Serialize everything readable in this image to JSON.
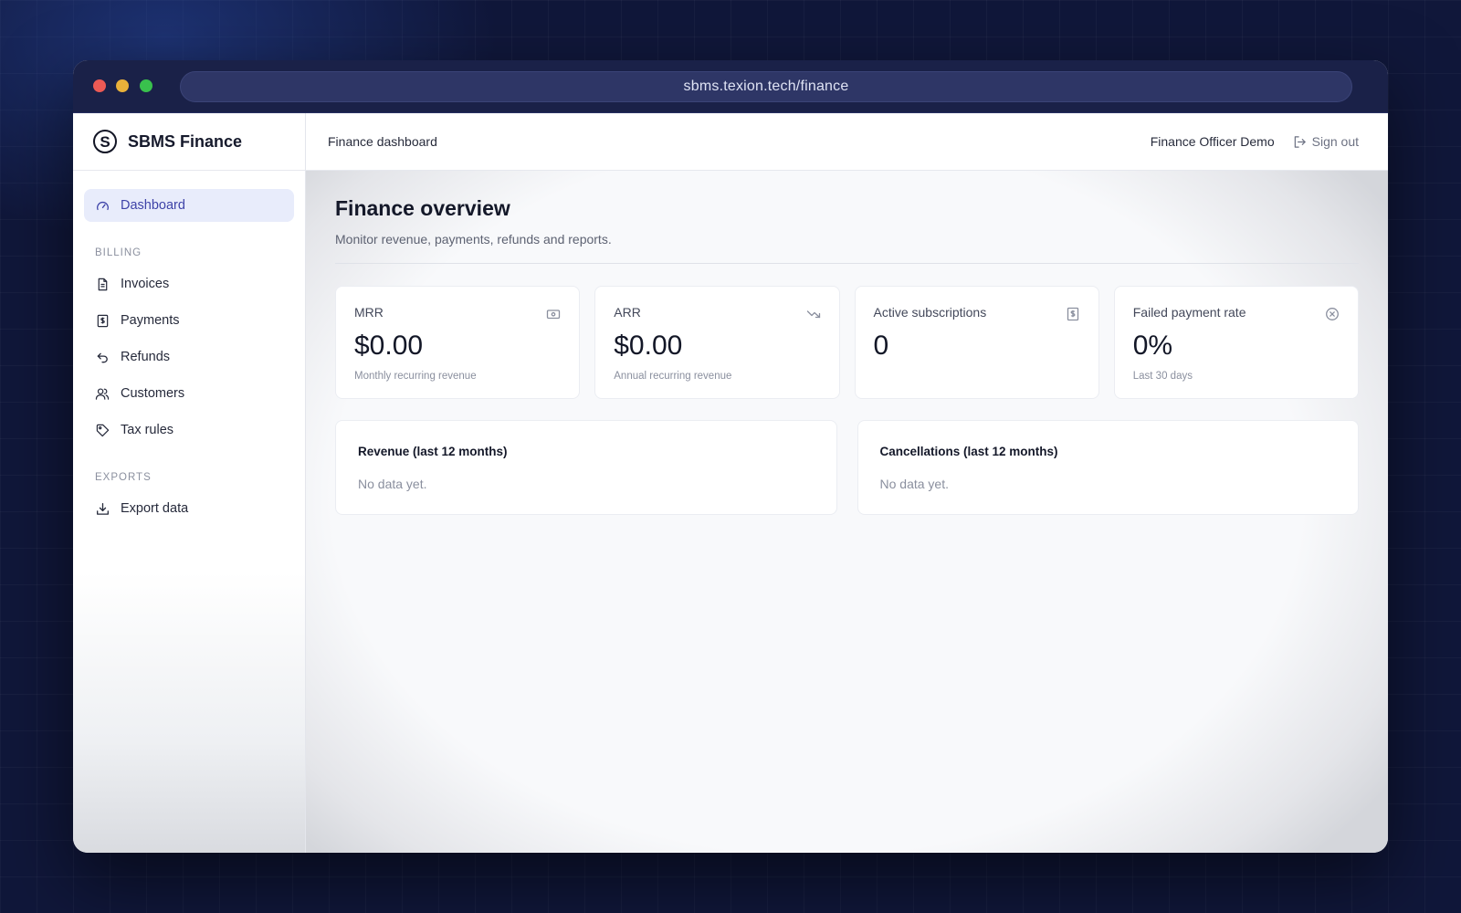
{
  "browser": {
    "url": "sbms.texion.tech/finance"
  },
  "sidebar": {
    "brand": {
      "logo_letter": "S",
      "name": "SBMS Finance"
    },
    "dashboard": {
      "label": "Dashboard",
      "icon": "gauge-icon"
    },
    "sections": [
      {
        "title": "BILLING",
        "items": [
          {
            "label": "Invoices",
            "icon": "document-icon"
          },
          {
            "label": "Payments",
            "icon": "receipt-icon"
          },
          {
            "label": "Refunds",
            "icon": "undo-arrow-icon"
          },
          {
            "label": "Customers",
            "icon": "users-icon"
          },
          {
            "label": "Tax rules",
            "icon": "tag-icon"
          }
        ]
      },
      {
        "title": "EXPORTS",
        "items": [
          {
            "label": "Export data",
            "icon": "download-icon"
          }
        ]
      }
    ]
  },
  "topbar": {
    "title": "Finance dashboard",
    "user_name": "Finance Officer Demo",
    "signout_label": "Sign out"
  },
  "page": {
    "title": "Finance overview",
    "subtitle": "Monitor revenue, payments, refunds and reports."
  },
  "stats": [
    {
      "label": "MRR",
      "value": "$0.00",
      "note": "Monthly recurring revenue",
      "icon": "banknote-icon"
    },
    {
      "label": "ARR",
      "value": "$0.00",
      "note": "Annual recurring revenue",
      "icon": "trend-down-icon"
    },
    {
      "label": "Active subscriptions",
      "value": "0",
      "note": "",
      "icon": "receipt-icon"
    },
    {
      "label": "Failed payment rate",
      "value": "0%",
      "note": "Last 30 days",
      "icon": "x-circle-icon"
    }
  ],
  "charts": [
    {
      "title": "Revenue (last 12 months)",
      "empty_text": "No data yet."
    },
    {
      "title": "Cancellations (last 12 months)",
      "empty_text": "No data yet."
    }
  ],
  "colors": {
    "accent": "#3e43a8",
    "active_bg": "#e8ecfb",
    "window_chrome": "#1a2148"
  }
}
